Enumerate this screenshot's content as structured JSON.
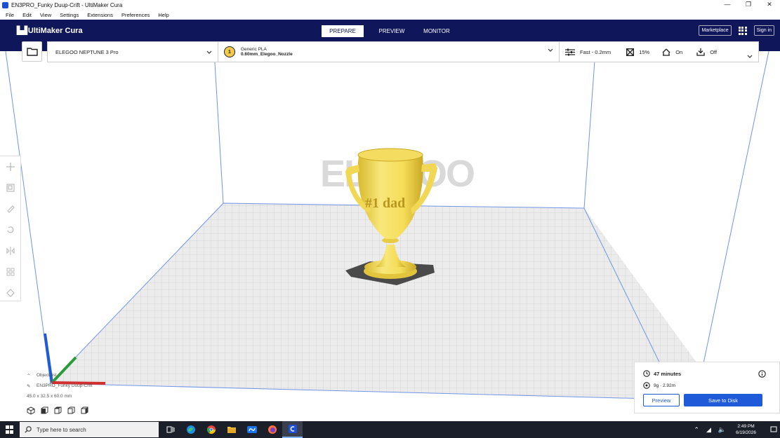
{
  "window": {
    "title": "EN3PRO_Funky Duup-Crift - UltiMaker Cura",
    "controls": [
      "minimize-icon",
      "restore-icon",
      "close-icon"
    ]
  },
  "menu": {
    "items": [
      "File",
      "Edit",
      "View",
      "Settings",
      "Extensions",
      "Preferences",
      "Help"
    ]
  },
  "header": {
    "brand": "UltiMaker Cura",
    "tabs": [
      "PREPARE",
      "PREVIEW",
      "MONITOR"
    ],
    "active_tab": "PREPARE",
    "marketplace": "Marketplace",
    "sign_in": "Sign in"
  },
  "toolbar": {
    "printer": "ELEGOO NEPTUNE 3 Pro",
    "extruder_number": "1",
    "material": "Generic PLA",
    "nozzle": "0.60mm_Elegoo_Nozzle",
    "profile": "Fast - 0.2mm",
    "infill": "15%",
    "support": "On",
    "adhesion": "Off"
  },
  "viewport": {
    "watermark": "ELEGOO",
    "model_text": "#1 dad",
    "colors": {
      "model": "#f5dd5a",
      "model_shade": "#d9b92e",
      "plate": "#ececec",
      "grid": "#cfcfcf",
      "frame": "#6f95e6"
    }
  },
  "object": {
    "section_label": "Object list",
    "name": "EN3PRO_Funky Duup-Crift",
    "dimensions": "45.0 x 32.5 x 60.0 mm"
  },
  "output": {
    "time": "47 minutes",
    "material_usage": "9g · 2.92m",
    "preview_button": "Preview",
    "save_button": "Save to Disk"
  },
  "taskbar": {
    "search_placeholder": "Type here to search",
    "time": "2:49 PM",
    "date": "6/19/2026"
  }
}
